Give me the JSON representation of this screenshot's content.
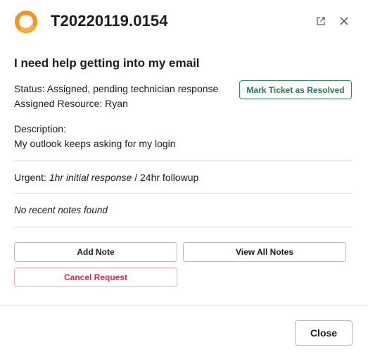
{
  "ticket": {
    "id": "T20220119.0154",
    "subject": "I need help getting into my email",
    "status_line": "Status: Assigned, pending technician response",
    "resource_line": "Assigned Resource: Ryan",
    "description_label": "Description:",
    "description_text": "My outlook keeps asking for my login",
    "priority_label": "Urgent:",
    "initial_response": "1hr initial response",
    "separator": "/",
    "followup": "24hr followup",
    "notes_status": "No recent notes found"
  },
  "buttons": {
    "mark_resolved": "Mark Ticket as Resolved",
    "add_note": "Add Note",
    "view_all_notes": "View All Notes",
    "cancel_request": "Cancel Request",
    "close": "Close"
  },
  "icons": {
    "logo": "orange-ring-logo-icon",
    "external": "external-link-icon",
    "close": "close-icon"
  },
  "colors": {
    "logo_orange": "#f7941d",
    "resolve_green": "#2e8b57",
    "cancel_pink": "#d22a5c"
  }
}
